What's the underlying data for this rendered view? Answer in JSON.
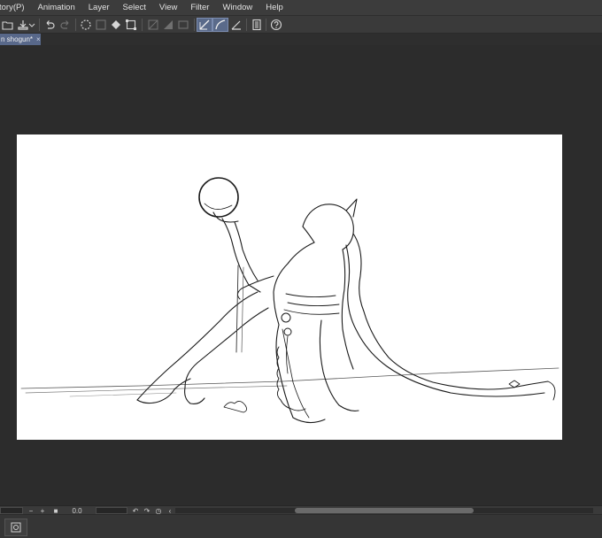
{
  "menu": {
    "items": [
      "tory(P)",
      "Animation",
      "Layer",
      "Select",
      "View",
      "Filter",
      "Window",
      "Help"
    ]
  },
  "toolbar": {
    "icons": [
      "open-icon",
      "save-icon",
      "dropdown-icon",
      "undo-icon",
      "redo-icon",
      "lasso-select-icon",
      "fill-icon",
      "transform-icon",
      "line-snap-icon",
      "curve-snap-icon",
      "ruler-icon",
      "document-icon",
      "help-icon"
    ]
  },
  "document_tab": {
    "title": "n shogun*",
    "close": "×"
  },
  "status": {
    "zoom_minus": "−",
    "zoom_plus": "+",
    "rotation_value": "0.0"
  },
  "colors": {
    "menubar": "#3c3c3c",
    "workspace": "#2c2c2c",
    "active_tab": "#58688a",
    "canvas": "#ffffff"
  }
}
